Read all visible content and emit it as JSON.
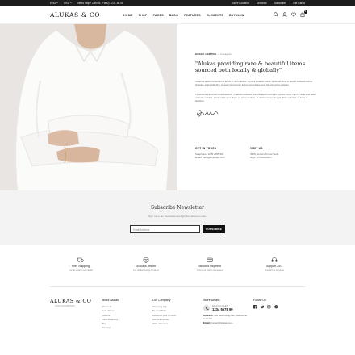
{
  "topbar": {
    "currency": "USD",
    "language": "ENG",
    "help": "Need help? Call us: (+800) 1231 5678",
    "links": [
      "Store Location",
      "Services",
      "Subscribe",
      "Gift Cards"
    ]
  },
  "header": {
    "logo": "ALUKAS & CO",
    "nav": [
      "HOME",
      "SHOP",
      "PAGES",
      "BLOG",
      "FEATURES",
      "ELEMENTS",
      "BUY NOW"
    ],
    "cart_count": "0"
  },
  "hero": {
    "crumbs_name": "GRACE HARTON",
    "crumbs_role": "Instagram",
    "quote": "\"Alukas providing rare & beautiful items sourced both locally & globally\"",
    "para1": "Vivamus auctor numeram et lorem in nibh ultrices. Nunc a sodales luctus, porta vel nunc in iaculis molestie lectus. Quisque et gravida nibh. Aliquam fermentum luctus scelerisque erat. Mauris varius pretium.",
    "para2": "Tu sentiorsg aspertes dosstrasda ib. Praesent posuere, lobortis auctor est quis, porttitor risus. Nam a nulla quis tellus vehicula sodales. Vivamus tempus libero eu tortor pretium, et ultricies lorem feugiat. Proin pulvinar ut dolor ut faucibus.",
    "contact": {
      "title1": "GET IN TOUCH",
      "line1a": "Telephone: 1235 2355 98",
      "line1b": "Email: hello@example.com",
      "title2": "VISIT US",
      "line2a": "4920 Jimston Tunnel Suite",
      "line2b": "0021 VN Rotterdam"
    }
  },
  "newsletter": {
    "title": "Subscribe Newsletter",
    "subtitle": "Sign up to our Newsletter and get the discount code.",
    "placeholder": "Email Address",
    "button": "SUBSCRIBE"
  },
  "features": [
    {
      "icon": "truck-icon",
      "title": "Free Shipping",
      "sub": "For all orders over $200"
    },
    {
      "icon": "box-return-icon",
      "title": "30 Days Return",
      "sub": "For an Exchange Product"
    },
    {
      "icon": "card-icon",
      "title": "Secured Payment",
      "sub": "Payment Cards Accepted"
    },
    {
      "icon": "headset-icon",
      "title": "Support 24/7",
      "sub": "Contact us Anytime"
    }
  ],
  "footer": {
    "logo": "ALUKAS & CO",
    "tagline": "GOLD & DIAMONDS",
    "about_title": "About Alukas",
    "about_links": [
      "About Us",
      "Core Values",
      "Careers",
      "Press Releases",
      "Blog",
      "Sitemap"
    ],
    "company_title": "Our Company",
    "company_links": [
      "Shopping App",
      "Be an Affiliate",
      "Advertise your Product",
      "Media Enquiries",
      "Other Services"
    ],
    "store_title": "Store Details",
    "help_q": "Need Any Help?",
    "phone": "1234 5678 90",
    "address_label": "Address:",
    "address": "502 New Design Str, Melbourne, Australia",
    "email_label": "Email:",
    "email": "contact@alukas.com",
    "follow_title": "Follow Us",
    "social": [
      "facebook-icon",
      "twitter-icon",
      "instagram-icon",
      "pinterest-icon"
    ]
  },
  "colors": {
    "topbar": "#1d1d1d",
    "newsletter_bg": "#f3f3f3",
    "button": "#111111"
  }
}
